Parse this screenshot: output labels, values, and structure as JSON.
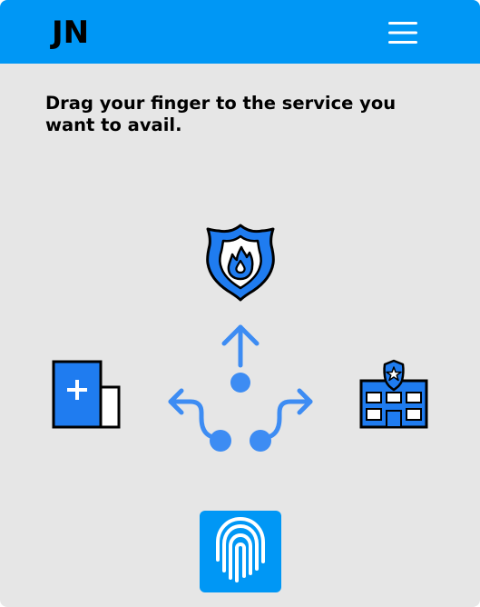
{
  "header": {
    "logo": "JN",
    "menu_icon": "hamburger-menu-icon"
  },
  "instruction": "Drag your finger to the service you want to avail.",
  "services": [
    {
      "id": "fire",
      "icon": "fire-department-badge-icon"
    },
    {
      "id": "hospital",
      "icon": "hospital-building-icon"
    },
    {
      "id": "police",
      "icon": "police-station-icon"
    }
  ],
  "gesture_guide": {
    "icon": "swipe-direction-arrows-icon"
  },
  "fingerprint": {
    "icon": "fingerprint-icon"
  },
  "colors": {
    "brand_blue": "#0097f5",
    "icon_blue": "#1f7cf0",
    "arrow_blue": "#3d8cf3",
    "background": "#e6e6e6"
  }
}
